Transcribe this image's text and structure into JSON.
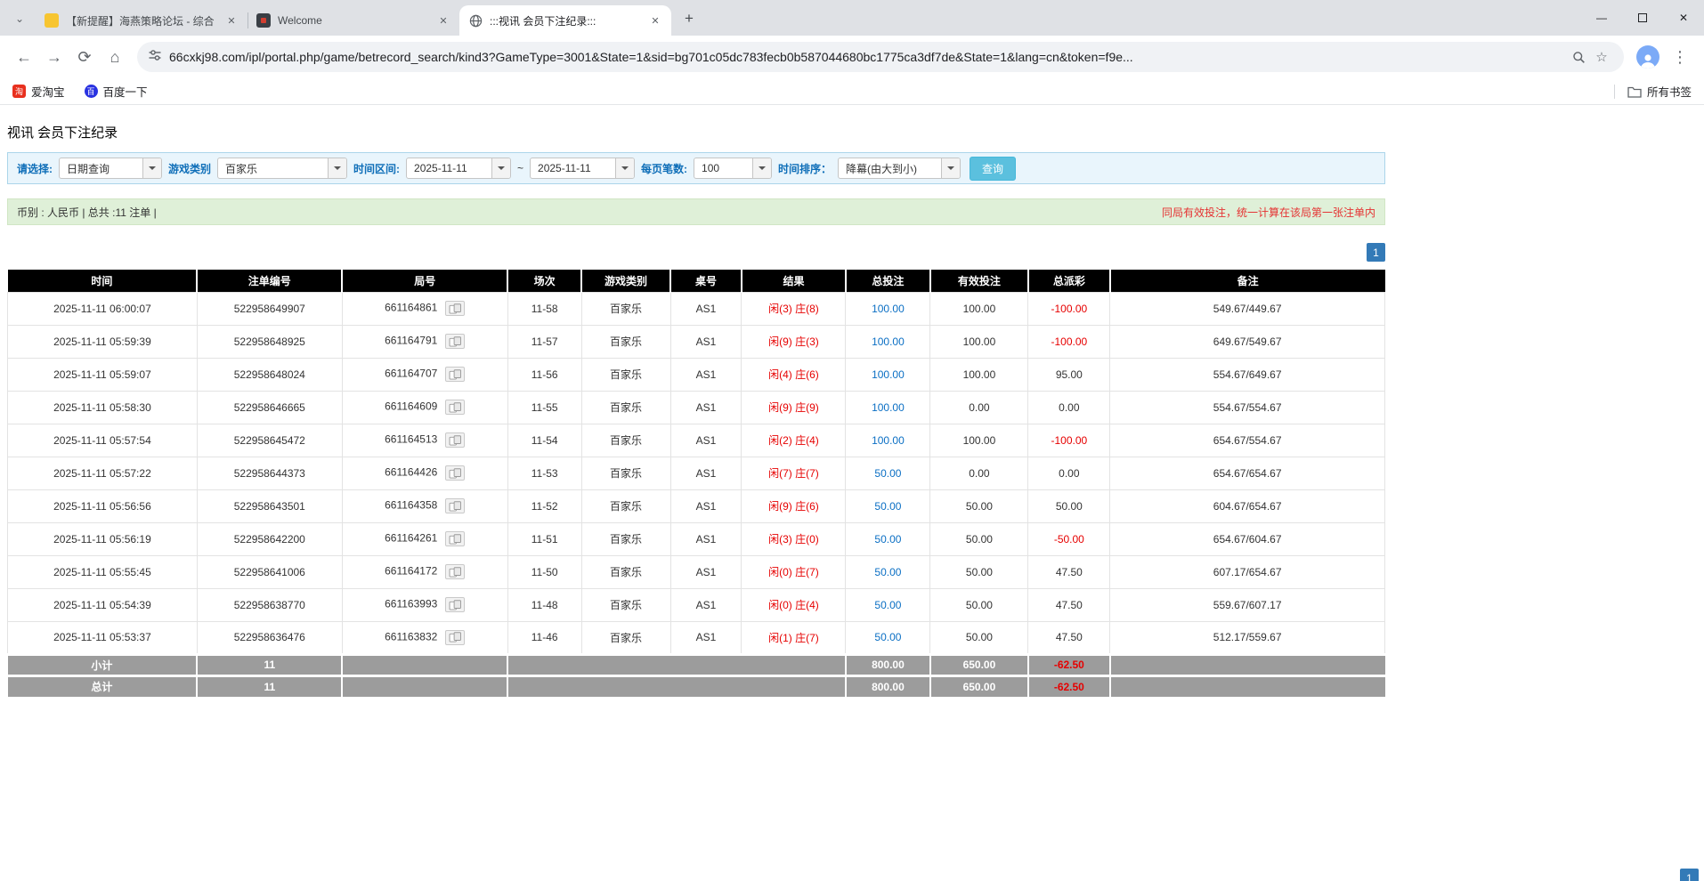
{
  "browser": {
    "tabs": [
      {
        "title": "【新提醒】海燕策略论坛 - 综合",
        "favicon": "forum-yellow-icon"
      },
      {
        "title": "Welcome",
        "favicon": "welcome-icon"
      },
      {
        "title": ":::视讯 会员下注纪录:::",
        "favicon": "globe-icon"
      }
    ],
    "url": "66cxkj98.com/ipl/portal.php/game/betrecord_search/kind3?GameType=3001&State=1&sid=bg701c05dc783fecb0b587044680bc1775ca3df7de&State=1&lang=cn&token=f9e...",
    "bookmarks": [
      {
        "label": "爱淘宝",
        "icon": "taobao-icon",
        "glyph": "淘"
      },
      {
        "label": "百度一下",
        "icon": "baidu-icon",
        "glyph": "百"
      }
    ],
    "all_bookmarks_label": "所有书签"
  },
  "colors": {
    "accent_blue": "#337ab7",
    "search_button": "#5bc0de",
    "link_blue": "#0b6fc4",
    "negative_red": "#e60000",
    "table_header_bg": "#000000",
    "table_footer_bg": "#9c9c9c",
    "filter_bg": "#e9f5fc",
    "info_bg": "#dff0d8"
  },
  "page": {
    "title": "视讯 会员下注纪录",
    "filters": {
      "select_label": "请选择:",
      "select_value": "日期查询",
      "game_type_label": "游戏类别",
      "game_type_value": "百家乐",
      "date_range_label": "时间区间:",
      "date_from": "2025-11-11",
      "tilde": "~",
      "date_to": "2025-11-11",
      "page_size_label": "每页笔数:",
      "page_size_value": "100",
      "sort_label": "时间排序：",
      "sort_value": "降幕(由大到小)",
      "search_button": "查询"
    },
    "info_bar": {
      "left": "币别 : 人民币 | 总共 :11 注单 |",
      "right": "同局有效投注，统一计算在该局第一张注单内"
    },
    "pagination": "1",
    "table": {
      "headers": [
        "时间",
        "注单编号",
        "局号",
        "场次",
        "游戏类别",
        "桌号",
        "结果",
        "总投注",
        "有效投注",
        "总派彩",
        "备注"
      ],
      "rows": [
        {
          "time": "2025-11-11 06:00:07",
          "bet_id": "522958649907",
          "round_id": "661164861",
          "session": "11-58",
          "game": "百家乐",
          "table_no": "AS1",
          "player": "闲(3)",
          "banker": "庄(8)",
          "total_bet": "100.00",
          "valid_bet": "100.00",
          "payout": "-100.00",
          "note": "549.67/449.67"
        },
        {
          "time": "2025-11-11 05:59:39",
          "bet_id": "522958648925",
          "round_id": "661164791",
          "session": "11-57",
          "game": "百家乐",
          "table_no": "AS1",
          "player": "闲(9)",
          "banker": "庄(3)",
          "total_bet": "100.00",
          "valid_bet": "100.00",
          "payout": "-100.00",
          "note": "649.67/549.67"
        },
        {
          "time": "2025-11-11 05:59:07",
          "bet_id": "522958648024",
          "round_id": "661164707",
          "session": "11-56",
          "game": "百家乐",
          "table_no": "AS1",
          "player": "闲(4)",
          "banker": "庄(6)",
          "total_bet": "100.00",
          "valid_bet": "100.00",
          "payout": "95.00",
          "note": "554.67/649.67"
        },
        {
          "time": "2025-11-11 05:58:30",
          "bet_id": "522958646665",
          "round_id": "661164609",
          "session": "11-55",
          "game": "百家乐",
          "table_no": "AS1",
          "player": "闲(9)",
          "banker": "庄(9)",
          "total_bet": "100.00",
          "valid_bet": "0.00",
          "payout": "0.00",
          "note": "554.67/554.67"
        },
        {
          "time": "2025-11-11 05:57:54",
          "bet_id": "522958645472",
          "round_id": "661164513",
          "session": "11-54",
          "game": "百家乐",
          "table_no": "AS1",
          "player": "闲(2)",
          "banker": "庄(4)",
          "total_bet": "100.00",
          "valid_bet": "100.00",
          "payout": "-100.00",
          "note": "654.67/554.67"
        },
        {
          "time": "2025-11-11 05:57:22",
          "bet_id": "522958644373",
          "round_id": "661164426",
          "session": "11-53",
          "game": "百家乐",
          "table_no": "AS1",
          "player": "闲(7)",
          "banker": "庄(7)",
          "total_bet": "50.00",
          "valid_bet": "0.00",
          "payout": "0.00",
          "note": "654.67/654.67"
        },
        {
          "time": "2025-11-11 05:56:56",
          "bet_id": "522958643501",
          "round_id": "661164358",
          "session": "11-52",
          "game": "百家乐",
          "table_no": "AS1",
          "player": "闲(9)",
          "banker": "庄(6)",
          "total_bet": "50.00",
          "valid_bet": "50.00",
          "payout": "50.00",
          "note": "604.67/654.67"
        },
        {
          "time": "2025-11-11 05:56:19",
          "bet_id": "522958642200",
          "round_id": "661164261",
          "session": "11-51",
          "game": "百家乐",
          "table_no": "AS1",
          "player": "闲(3)",
          "banker": "庄(0)",
          "total_bet": "50.00",
          "valid_bet": "50.00",
          "payout": "-50.00",
          "note": "654.67/604.67"
        },
        {
          "time": "2025-11-11 05:55:45",
          "bet_id": "522958641006",
          "round_id": "661164172",
          "session": "11-50",
          "game": "百家乐",
          "table_no": "AS1",
          "player": "闲(0)",
          "banker": "庄(7)",
          "total_bet": "50.00",
          "valid_bet": "50.00",
          "payout": "47.50",
          "note": "607.17/654.67"
        },
        {
          "time": "2025-11-11 05:54:39",
          "bet_id": "522958638770",
          "round_id": "661163993",
          "session": "11-48",
          "game": "百家乐",
          "table_no": "AS1",
          "player": "闲(0)",
          "banker": "庄(4)",
          "total_bet": "50.00",
          "valid_bet": "50.00",
          "payout": "47.50",
          "note": "559.67/607.17"
        },
        {
          "time": "2025-11-11 05:53:37",
          "bet_id": "522958636476",
          "round_id": "661163832",
          "session": "11-46",
          "game": "百家乐",
          "table_no": "AS1",
          "player": "闲(1)",
          "banker": "庄(7)",
          "total_bet": "50.00",
          "valid_bet": "50.00",
          "payout": "47.50",
          "note": "512.17/559.67"
        }
      ],
      "subtotal": {
        "label": "小计",
        "count": "11",
        "total_bet": "800.00",
        "valid_bet": "650.00",
        "payout": "-62.50"
      },
      "total": {
        "label": "总计",
        "count": "11",
        "total_bet": "800.00",
        "valid_bet": "650.00",
        "payout": "-62.50"
      }
    }
  }
}
